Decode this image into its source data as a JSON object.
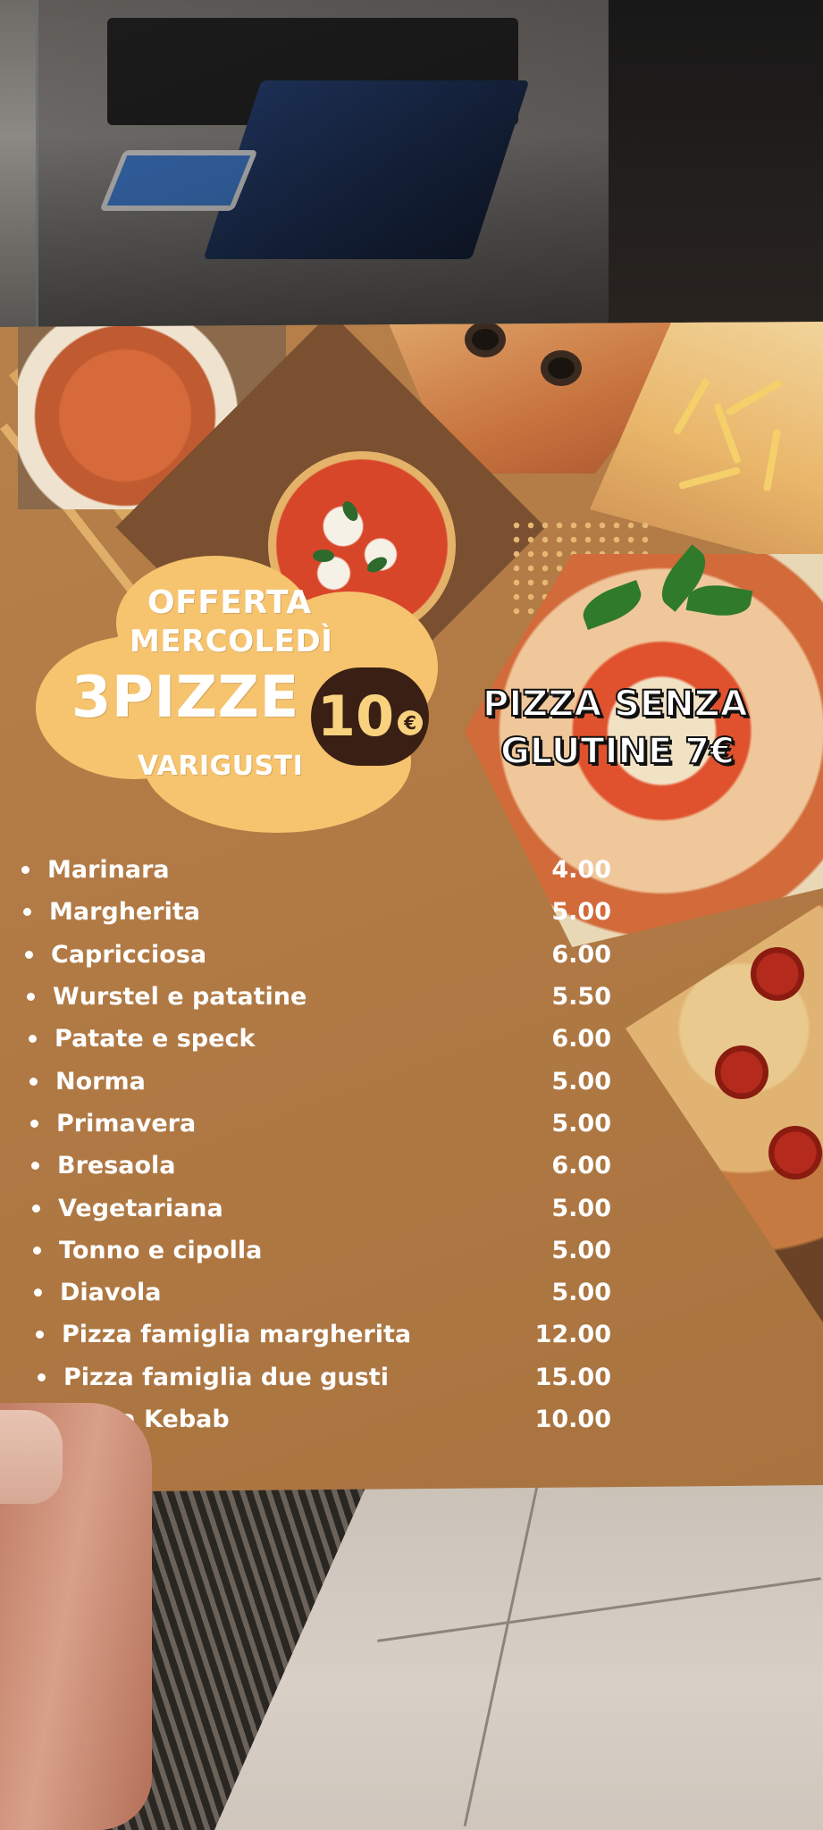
{
  "offer": {
    "line1": "OFFERTA",
    "line2": "MERCOLEDÌ",
    "line3": "3PIZZE",
    "line4": "VARIGUSTI",
    "price": "10",
    "currency": "€"
  },
  "gluten_free": {
    "line1": "PIZZA SENZA",
    "line2": "GLUTINE 7€"
  },
  "menu_items": [
    {
      "name": "Marinara",
      "price": "4.00"
    },
    {
      "name": "Margherita",
      "price": "5.00"
    },
    {
      "name": "Capricciosa",
      "price": "6.00"
    },
    {
      "name": "Wurstel e patatine",
      "price": "5.50"
    },
    {
      "name": "Patate e speck",
      "price": "6.00"
    },
    {
      "name": "Norma",
      "price": "5.00"
    },
    {
      "name": "Primavera",
      "price": "5.00"
    },
    {
      "name": "Bresaola",
      "price": "6.00"
    },
    {
      "name": "Vegetariana",
      "price": "5.00"
    },
    {
      "name": "Tonno e cipolla",
      "price": "5.00"
    },
    {
      "name": "Diavola",
      "price": "5.00"
    },
    {
      "name": "Pizza famiglia margherita",
      "price": "12.00"
    },
    {
      "name": "Pizza famiglia due gusti",
      "price": "15.00"
    },
    {
      "name": "Pizza Kebab",
      "price": "10.00"
    }
  ],
  "colors": {
    "paper": "#b17a45",
    "cloud": "#f6c46f",
    "badge": "#3a1f14",
    "text": "#ffffff"
  }
}
